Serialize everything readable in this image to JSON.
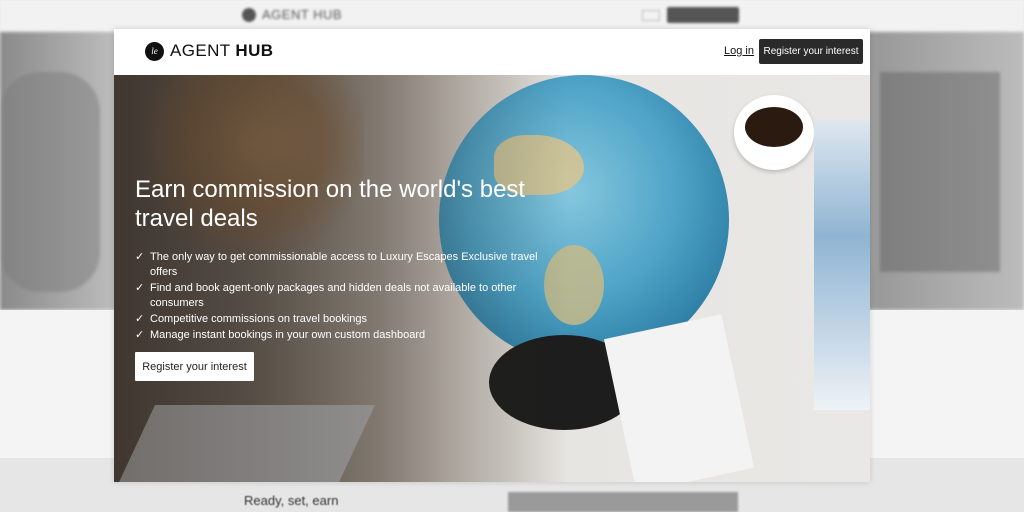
{
  "background_page": {
    "logo_text": "AGENT HUB",
    "section_heading": "Ready, set, earn"
  },
  "header": {
    "logo": {
      "icon": "le-monogram-icon",
      "icon_text": "le",
      "brand_light": "AGENT ",
      "brand_bold": "HUB"
    },
    "login_label": "Log in",
    "register_label": "Register your interest"
  },
  "hero": {
    "title": "Earn commission on the world's best travel deals",
    "benefits": [
      "The only way to get commissionable access to Luxury Escapes Exclusive travel offers",
      "Find and book agent-only packages and hidden deals not available to other consumers",
      "Competitive commissions on travel bookings",
      "Manage instant bookings in your own custom dashboard"
    ],
    "check_icon": "check-icon",
    "check_glyph": "✓",
    "cta_label": "Register your interest"
  },
  "colors": {
    "primary_button": "#2a2a2a",
    "hero_text": "#ffffff"
  }
}
